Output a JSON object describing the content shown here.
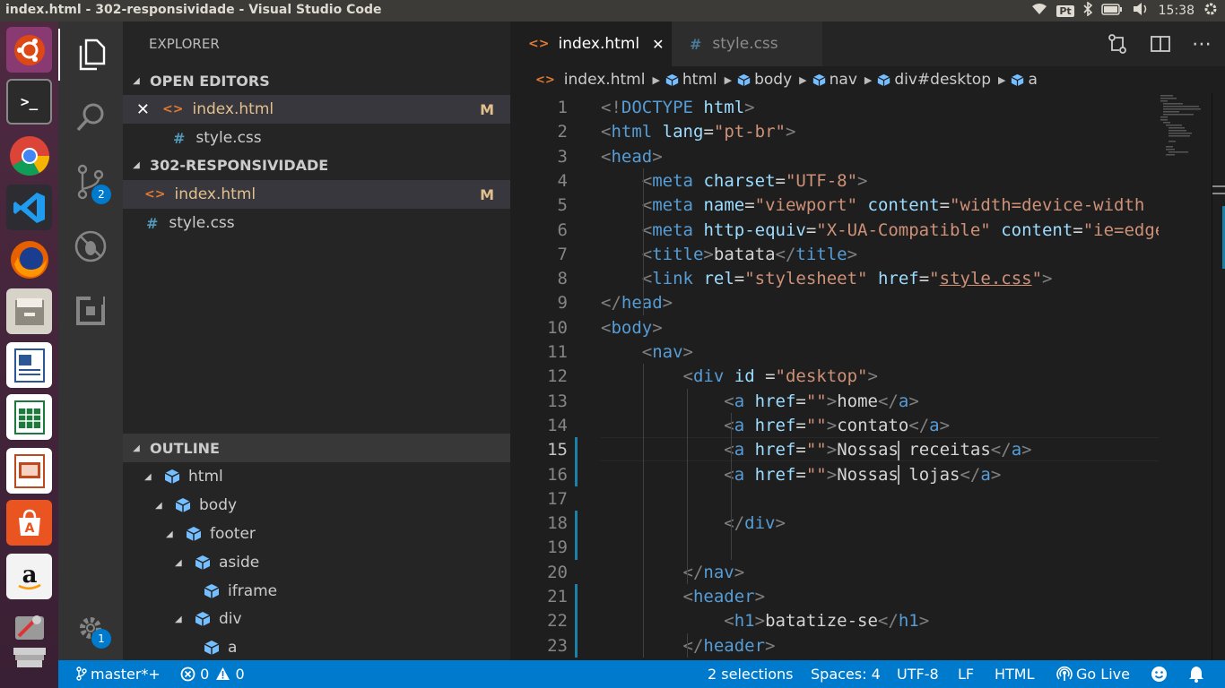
{
  "window": {
    "title": "index.html - 302-responsividade - Visual Studio Code"
  },
  "tray": {
    "keyboard": "Pt",
    "clock": "15:38"
  },
  "launcher": {
    "apps": [
      "ubuntu-logo-icon",
      "terminal-icon",
      "chrome-icon",
      "vscode-icon",
      "firefox-icon",
      "files-icon",
      "writer-icon",
      "calc-icon",
      "impress-icon",
      "software-center-icon",
      "amazon-icon",
      "settings-icon",
      "trash-icon"
    ]
  },
  "activity": {
    "scm_badge": "2",
    "settings_badge": "1"
  },
  "sidebar": {
    "title": "EXPLORER",
    "open_editors_header": "OPEN EDITORS",
    "open_editors": [
      {
        "name": "index.html",
        "status": "M"
      },
      {
        "name": "style.css",
        "status": ""
      }
    ],
    "folder_header": "302-RESPONSIVIDADE",
    "files": [
      {
        "name": "index.html",
        "status": "M"
      },
      {
        "name": "style.css",
        "status": ""
      }
    ],
    "outline_header": "OUTLINE",
    "outline": [
      {
        "label": "html",
        "expandable": true
      },
      {
        "label": "body",
        "expandable": true
      },
      {
        "label": "footer",
        "expandable": true
      },
      {
        "label": "aside",
        "expandable": true
      },
      {
        "label": "iframe",
        "expandable": false
      },
      {
        "label": "div",
        "expandable": true
      },
      {
        "label": "a",
        "expandable": false
      }
    ]
  },
  "tabs": [
    {
      "label": "index.html",
      "active": true
    },
    {
      "label": "style.css",
      "active": false
    }
  ],
  "breadcrumbs": [
    "index.html",
    "html",
    "body",
    "nav",
    "div#desktop",
    "a"
  ],
  "editor": {
    "current_line": 15,
    "lines": [
      "<!DOCTYPE html>",
      "<html lang=\"pt-br\">",
      "<head>",
      "    <meta charset=\"UTF-8\">",
      "    <meta name=\"viewport\" content=\"width=device-width",
      "    <meta http-equiv=\"X-UA-Compatible\" content=\"ie=edge\">",
      "    <title>batata</title>",
      "    <link rel=\"stylesheet\" href=\"style.css\">",
      "</head>",
      "<body>",
      "    <nav>",
      "        <div id =\"desktop\">",
      "            <a href=\"\">home</a>",
      "            <a href=\"\">contato</a>",
      "            <a href=\"\">Nossas receitas</a>",
      "            <a href=\"\">Nossas lojas</a>",
      "",
      "            </div>",
      "",
      "        </nav>",
      "        <header>",
      "            <h1>batatize-se</h1>",
      "        </header>"
    ]
  },
  "status": {
    "branch": "master*+",
    "errors": "0",
    "warnings": "0",
    "selections": "2 selections",
    "spaces": "Spaces: 4",
    "encoding": "UTF-8",
    "eol": "LF",
    "language": "HTML",
    "golive": "Go Live"
  },
  "colors": {
    "statusbar": "#007acc",
    "sidebar": "#252526",
    "editor": "#1e1e1e",
    "activitybar": "#333333",
    "launcher": "#4e2a41"
  }
}
